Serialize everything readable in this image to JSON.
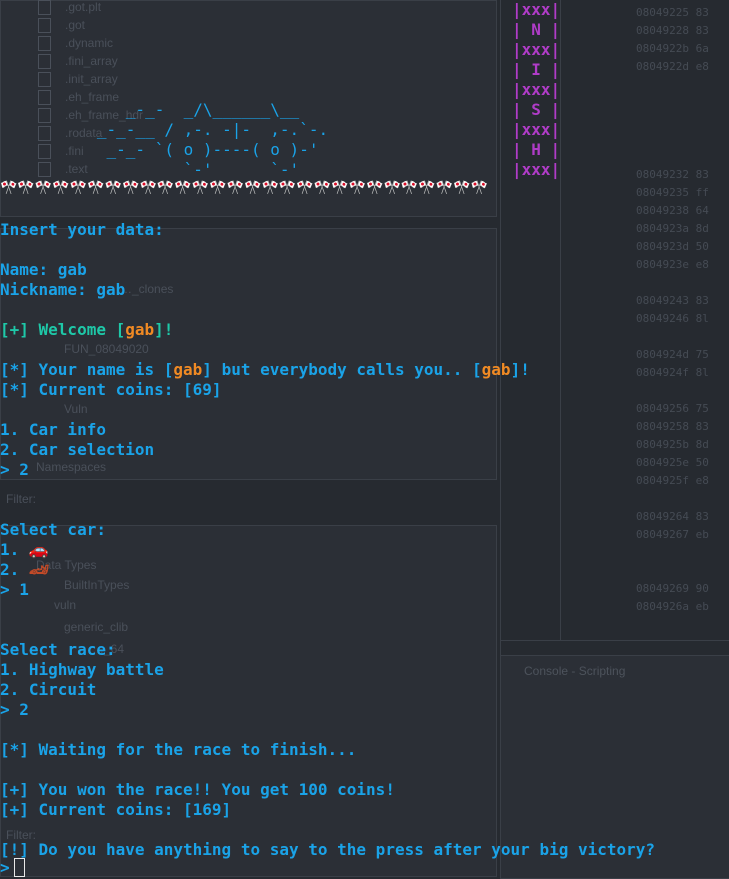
{
  "background": {
    "files": [
      ".got.plt",
      ".got",
      ".dynamic",
      ".fini_array",
      ".init_array",
      ".eh_frame",
      ".eh_frame_hdr",
      ".rodata",
      ".fini",
      ".text"
    ],
    "tree_items": [
      "FUN_08049020",
      "…_clones",
      "Vuln",
      "Namespaces",
      "Data Types",
      "BuiltInTypes",
      "vuln",
      "generic_clib",
      "…_64"
    ],
    "filter_label": "Filter:",
    "console_title": "Console - Scripting",
    "addresses": [
      "08049225 83",
      "08049228 83",
      "0804922b 6a",
      "0804922d e8",
      "",
      "",
      "",
      "",
      "",
      "08049232 83",
      "08049235 ff",
      "08049238 64",
      "0804923a 8d",
      "0804923d 50",
      "0804923e e8",
      "",
      "08049243 83",
      "08049246 8l",
      "",
      "0804924d 75",
      "0804924f 8l",
      "",
      "08049256 75",
      "08049258 83",
      "0804925b 8d",
      "0804925e 50",
      "0804925f e8",
      "",
      "08049264 83",
      "08049267 eb",
      "",
      "",
      "08049269 90",
      "0804926a eb"
    ]
  },
  "ascii_art": [
    "      _-_-  _/\\______\\__",
    "   _-_-__ / ,-. -|-  ,-.`-.",
    "    _-_- `( o )----( o )-'",
    "            `-'      `-'"
  ],
  "ninja_banner": [
    "|xxx|",
    "| N |",
    "|xxx|",
    "| I |",
    "|xxx|",
    "| S |",
    "|xxx|",
    "| H |",
    "|xxx|"
  ],
  "flags_row": "🎌🎌🎌🎌🎌🎌🎌🎌🎌🎌🎌🎌🎌🎌🎌🎌🎌🎌🎌🎌🎌🎌🎌🎌🎌🎌🎌🎌",
  "terminal": {
    "insert_data": "Insert your data:",
    "name_line": "Name: gab",
    "nickname_line": "Nickname: gab",
    "welcome_prefix": "[+] Welcome [",
    "welcome_name": "gab",
    "welcome_suffix": "]!",
    "your_name_prefix": "[*] Your name is [",
    "your_name_value": "gab",
    "your_name_middle": "] but everybody calls you.. [",
    "your_name_nick": "gab",
    "your_name_suffix": "]!",
    "coins_line": "[*] Current coins: [69]",
    "menu_1": "1. Car info",
    "menu_2": "2. Car selection",
    "menu_input": "> 2",
    "select_car": "Select car:",
    "car_1_prefix": "1. ",
    "car_1_icon": "🚗",
    "car_2_prefix": "2. ",
    "car_2_icon": "🏎",
    "car_input": "> 1",
    "select_race": "Select race:",
    "race_1": "1. Highway battle",
    "race_2": "2. Circuit",
    "race_input": "> 2",
    "waiting": "[*] Waiting for the race to finish...",
    "won": "[+] You won the race!! You get 100 coins!",
    "coins_after": "[+] Current coins: [169]",
    "press_question": "[!] Do you have anything to say to the press after your big victory?",
    "prompt": ">"
  }
}
